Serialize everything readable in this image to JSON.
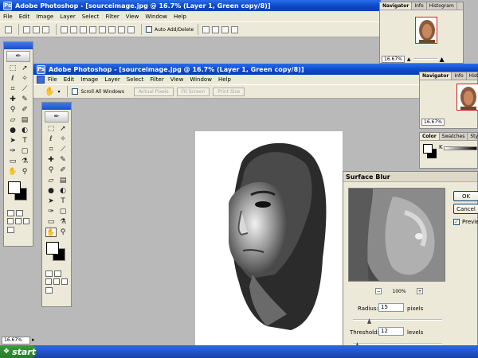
{
  "back_window": {
    "title": "Adobe Photoshop - [sourceimage.jpg @ 16.7% (Layer 1, Green copy/8)]",
    "menu": [
      "File",
      "Edit",
      "Image",
      "Layer",
      "Select",
      "Filter",
      "View",
      "Window",
      "Help"
    ],
    "auto_add_delete": "Auto Add/Delete"
  },
  "front_window": {
    "title": "Adobe Photoshop - [sourceimage.jpg @ 16.7% (Layer 1, Green copy/8)]",
    "menu": [
      "File",
      "Edit",
      "Image",
      "Layer",
      "Select",
      "Filter",
      "View",
      "Window",
      "Help"
    ],
    "options": {
      "scroll_all": "Scroll All Windows",
      "actual_pixels": "Actual Pixels",
      "fit_screen": "Fit Screen",
      "print_size": "Print Size"
    }
  },
  "navigator_top": {
    "tabs": [
      "Navigator",
      "Info",
      "Histogram"
    ],
    "zoom": "16.67%"
  },
  "navigator_mid": {
    "tabs": [
      "Navigator",
      "Info",
      "Histo"
    ],
    "zoom": "16.67%"
  },
  "color_panel": {
    "tabs": [
      "Color",
      "Swatches",
      "Styles"
    ],
    "channel": "K"
  },
  "status": {
    "zoom": "16.67%"
  },
  "surface_blur": {
    "title": "Surface Blur",
    "ok": "OK",
    "cancel": "Cancel",
    "preview_label": "Preview",
    "preview_checked": true,
    "zoom": "100%",
    "zoom_minus": "−",
    "zoom_plus": "+",
    "radius_label": "Radius:",
    "radius_value": "15",
    "radius_unit": "pixels",
    "radius_level": 0.18,
    "threshold_label": "Threshold:",
    "threshold_value": "12",
    "threshold_unit": "levels",
    "threshold_level": 0.05
  },
  "taskbar": {
    "start_label": "start"
  },
  "colors": {
    "xp_blue": "#0d48c9",
    "start_green": "#2f8a2f",
    "panel_bg": "#ece9d8"
  },
  "icons": [
    "feather-logo-icon",
    "move-icon",
    "marquee-icon",
    "lasso-icon",
    "wand-icon",
    "crop-icon",
    "slice-icon",
    "heal-icon",
    "brush-icon",
    "stamp-icon",
    "history-brush-icon",
    "eraser-icon",
    "gradient-icon",
    "blur-icon",
    "dodge-icon",
    "path-select-icon",
    "type-icon",
    "pen-icon",
    "shape-icon",
    "notes-icon",
    "eyedropper-icon",
    "hand-icon",
    "zoom-icon"
  ]
}
